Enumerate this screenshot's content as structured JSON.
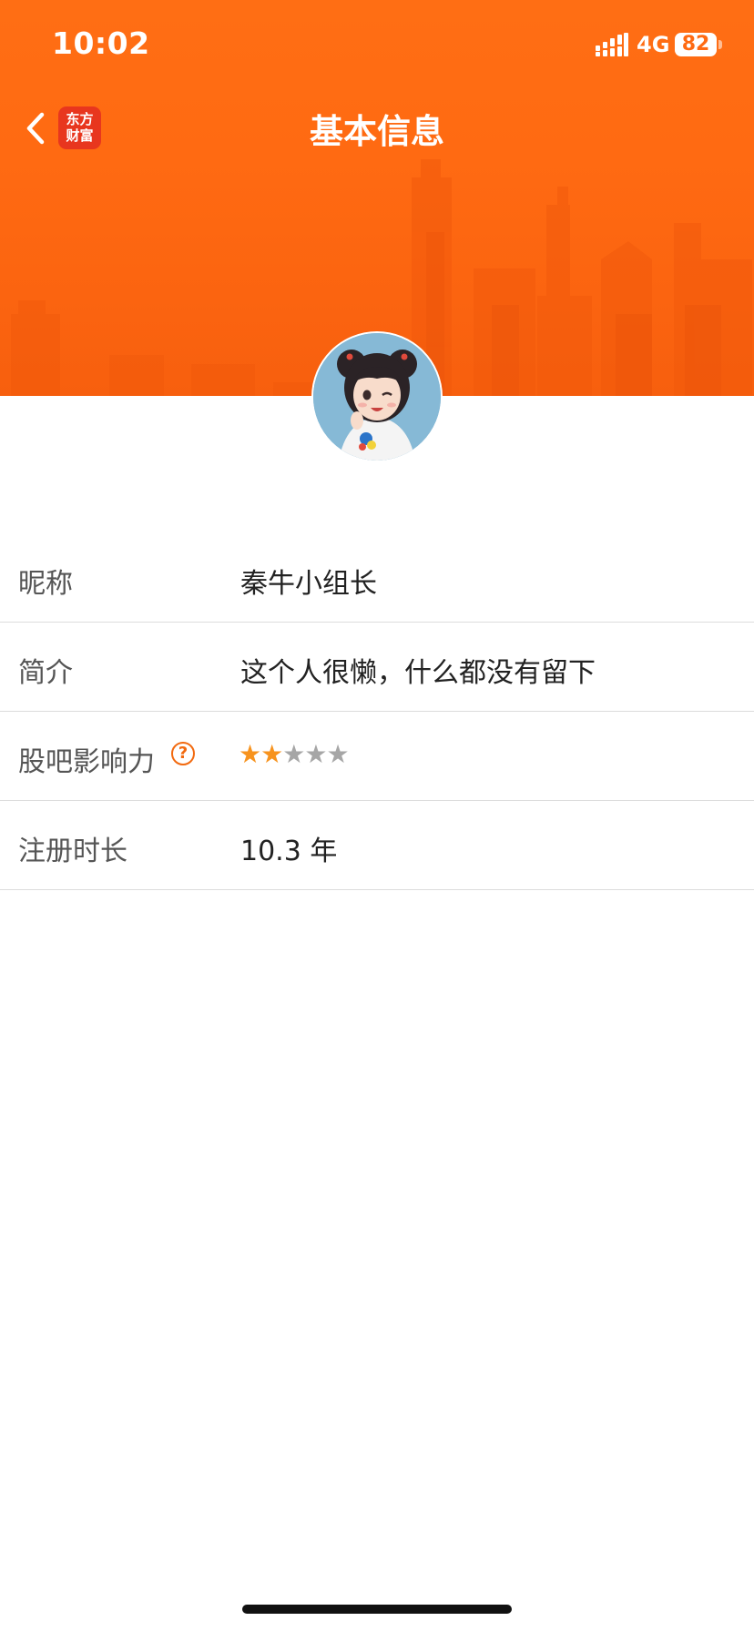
{
  "status_bar": {
    "time": "10:02",
    "network": "4G",
    "battery": "82"
  },
  "nav": {
    "title": "基本信息",
    "logo_line1": "东方",
    "logo_line2": "财富"
  },
  "profile": {
    "rows": [
      {
        "label": "昵称",
        "value": "秦牛小组长"
      },
      {
        "label": "简介",
        "value": "这个人很懒，什么都没有留下"
      },
      {
        "label": "股吧影响力",
        "rating": 2,
        "rating_max": 5
      },
      {
        "label": "注册时长",
        "value": "10.3 年"
      }
    ]
  },
  "icons": {
    "back": "chevron-left-icon",
    "help": "question-circle-icon",
    "star_on": "star-filled-icon",
    "star_off": "star-empty-icon"
  },
  "colors": {
    "header": "#ff6a12",
    "accent": "#f26a10",
    "star_on": "#f7931e",
    "star_off": "#a6a6a6"
  }
}
